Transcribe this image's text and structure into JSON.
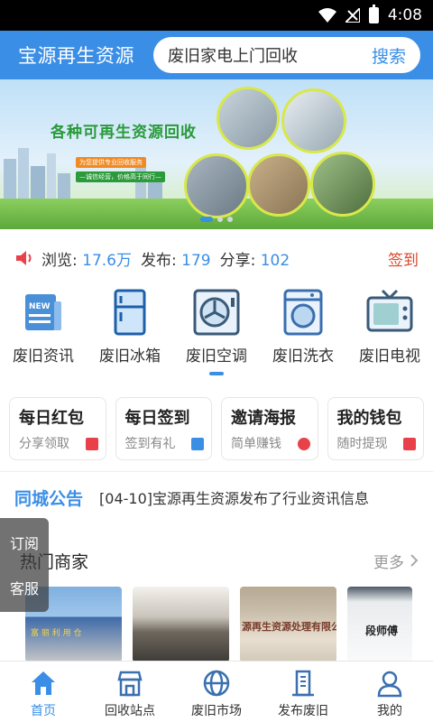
{
  "status_bar": {
    "time": "4:08"
  },
  "header": {
    "app_title": "宝源再生资源",
    "search": {
      "value": "废旧家电上门回收",
      "button_label": "搜索"
    }
  },
  "banner": {
    "headline": "各种可再生资源回收",
    "sub_line_1": "为您提供专业回收服务",
    "sub_line_2": "—诚信经营，价格高于同行—",
    "active_slide": 1,
    "slide_count": 3
  },
  "stats": {
    "views_label": "浏览:",
    "views_value": "17.6万",
    "posts_label": "发布:",
    "posts_value": "179",
    "shares_label": "分享:",
    "shares_value": "102",
    "sign_in_label": "签到"
  },
  "categories": [
    {
      "label": "废旧资讯",
      "icon": "news-icon"
    },
    {
      "label": "废旧冰箱",
      "icon": "fridge-icon"
    },
    {
      "label": "废旧空调",
      "icon": "air-conditioner-icon"
    },
    {
      "label": "废旧洗衣",
      "icon": "washing-machine-icon"
    },
    {
      "label": "废旧电视",
      "icon": "tv-icon"
    }
  ],
  "cards": [
    {
      "title": "每日红包",
      "sub": "分享领取",
      "badge_color": "#e8414a"
    },
    {
      "title": "每日签到",
      "sub": "签到有礼",
      "badge_color": "#3a8ee6"
    },
    {
      "title": "邀请海报",
      "sub": "简单赚钱",
      "badge_color": "#e8414a"
    },
    {
      "title": "我的钱包",
      "sub": "随时提现",
      "badge_color": "#e8414a"
    }
  ],
  "notice": {
    "title": "同城公告",
    "text": "[04-10]宝源再生资源发布了行业资讯信息"
  },
  "float_panel": {
    "subscribe": "订阅",
    "service": "客服"
  },
  "merchants": {
    "title": "热门商家",
    "more": "更多",
    "items": [
      {
        "name": "merchant-1",
        "sign": "富 丽 利 用 仓"
      },
      {
        "name": "merchant-2",
        "sign": ""
      },
      {
        "name": "merchant-3",
        "sign": "源再生资源处理有限公"
      },
      {
        "name": "merchant-4",
        "sign": "段师傅"
      }
    ]
  },
  "bottom_nav": [
    {
      "label": "首页",
      "icon": "home-icon",
      "active": true
    },
    {
      "label": "回收站点",
      "icon": "shop-icon",
      "active": false
    },
    {
      "label": "废旧市场",
      "icon": "globe-icon",
      "active": false
    },
    {
      "label": "发布废旧",
      "icon": "building-icon",
      "active": false
    },
    {
      "label": "我的",
      "icon": "user-icon",
      "active": false
    }
  ],
  "colors": {
    "primary": "#3a8ee6",
    "accent_red": "#d9472b"
  }
}
